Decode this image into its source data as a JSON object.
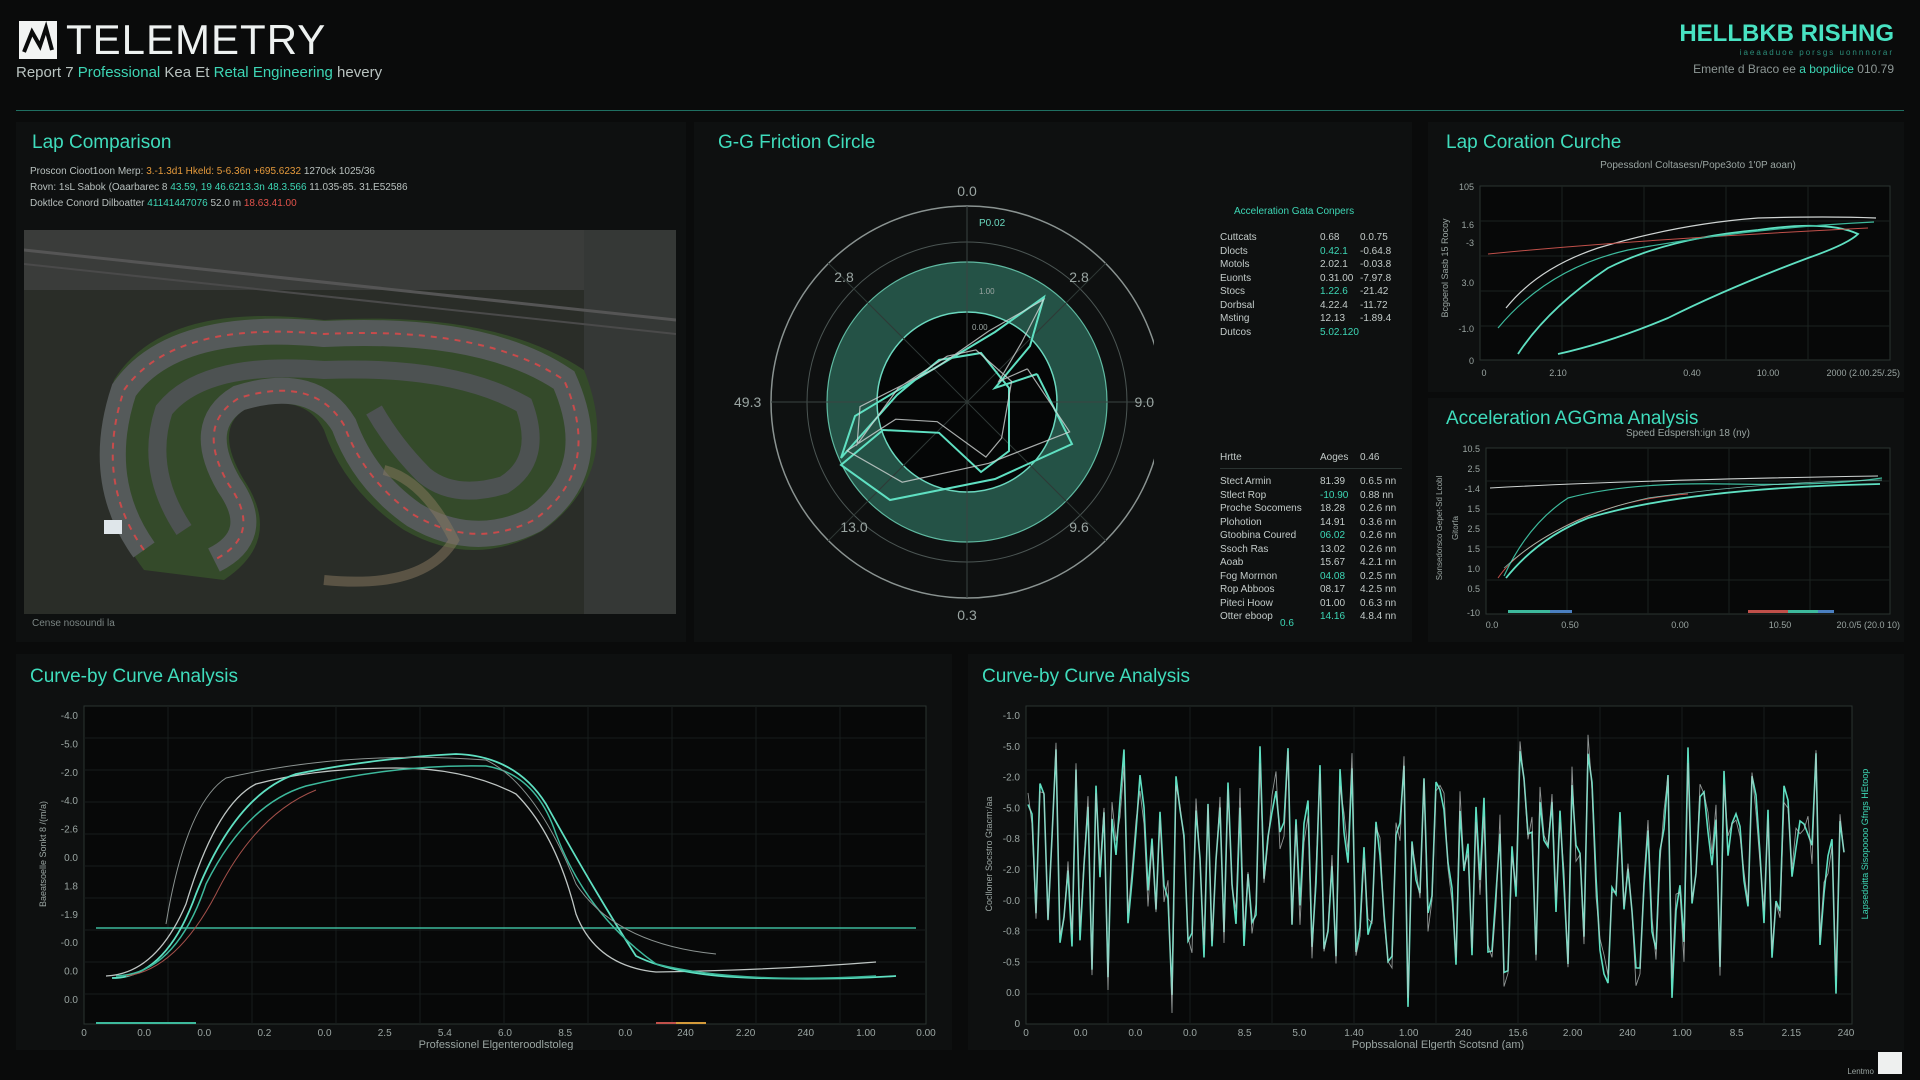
{
  "header": {
    "title": "TELEMETRY",
    "subtitle_parts": [
      "Report 7  ",
      "Professional",
      " Kea Et ",
      "Retal",
      " Engineering",
      " hevery"
    ],
    "brand": "HELLBKB RISHNG",
    "brand_sub": "iaeaaduoe porsgs uonnnorar",
    "meta_left": "Emente d Braco ee ",
    "meta_teal": "a bopdiice",
    "meta_right": "  010.79"
  },
  "lap_comparison": {
    "title": "Lap Comparison",
    "info_rows": [
      {
        "label": "Proscon Cioot1oon Merp:",
        "v1": "3.-1.3d1 Hkeld:",
        "v2": " 5-6.36n",
        "v3": " +695.6232",
        "v4": " 1270ck 1025/36"
      },
      {
        "label": "Rovn: 1sL Sabok (Oaarbarec 8",
        "v1": "43.59, 19 46.6213.3n",
        "v2": " 48.3.566",
        "v3": " 11.035-85. 31.E52586",
        "v4": ""
      },
      {
        "label": "Doktlce Conord Dilboatter",
        "v1": "41141447076",
        "v2": " 52.0 m",
        "v3": " 18.63.41.00",
        "v4": ""
      }
    ],
    "caption": "Cense nosoundi la"
  },
  "gg_circle": {
    "title": "G-G Friction Circle",
    "labels": [
      "0.0",
      "2.8",
      "2.8",
      "49.3",
      "9.0",
      "13.0",
      "9.6",
      "0.3"
    ],
    "inner_labels": [
      "P0.02",
      "1.00",
      "0.00"
    ],
    "trace": [
      [
        0.5,
        -0.2
      ],
      [
        0.75,
        0.3
      ],
      [
        0.2,
        0.55
      ],
      [
        -0.55,
        0.7
      ],
      [
        -0.9,
        0.45
      ],
      [
        -0.6,
        0.2
      ],
      [
        -0.2,
        0.22
      ],
      [
        0.1,
        0.5
      ],
      [
        0.3,
        0.35
      ],
      [
        0.3,
        -0.1
      ],
      [
        0.1,
        -0.35
      ],
      [
        -0.2,
        -0.3
      ],
      [
        -0.5,
        -0.05
      ],
      [
        -0.9,
        0.4
      ],
      [
        -0.8,
        0.1
      ],
      [
        -0.3,
        -0.2
      ],
      [
        0.2,
        -0.5
      ],
      [
        0.55,
        -0.75
      ],
      [
        0.45,
        -0.4
      ],
      [
        0.2,
        -0.1
      ],
      [
        0.5,
        -0.2
      ]
    ]
  },
  "acc_stats": {
    "header": "Acceleration Gata Conpers",
    "rows1": [
      {
        "k": "Cuttcats",
        "a": "0.68",
        "b": "0.0.75"
      },
      {
        "k": "Dlocts",
        "a": "0.42.1",
        "b": "-0.64.8"
      },
      {
        "k": "Motols",
        "a": "2.02.1",
        "b": "-0.03.8"
      },
      {
        "k": "Euonts",
        "a": "0.31.00",
        "b": "-7.97.8"
      },
      {
        "k": "Stocs",
        "a": "1.22.6",
        "b": "-21.42"
      },
      {
        "k": "Dorbsal",
        "a": "4.22.4",
        "b": "-11.72"
      },
      {
        "k": "Msting",
        "a": "12.13",
        "b": "-1.89.4"
      },
      {
        "k": "Dutcos",
        "a": "5.02.120",
        "b": ""
      }
    ],
    "sub_header": {
      "k": "Hrtte",
      "a": "Aoges",
      "b": "0.46"
    },
    "rows2": [
      {
        "k": "Stect Armin",
        "a": "81.39",
        "b": "0.6.5 nn"
      },
      {
        "k": "Stlect Rop",
        "a": "-10.90",
        "b": "0.88 nn"
      },
      {
        "k": "Proche Socomens",
        "a": "18.28",
        "b": "0.2.6 nn"
      },
      {
        "k": "Plohotion",
        "a": "14.91",
        "b": "0.3.6 nn"
      },
      {
        "k": "Gtoobina Coured",
        "a": "06.02",
        "b": "0.2.6 nn"
      },
      {
        "k": "Ssoch Ras",
        "a": "13.02",
        "b": "0.2.6 nn"
      },
      {
        "k": "Aoab",
        "a": "15.67",
        "b": "4.2.1 nn"
      },
      {
        "k": "Fog Morrnon",
        "a": "04.08",
        "b": "0.2.5 nn"
      },
      {
        "k": "Rop Abboos",
        "a": "08.17",
        "b": "4.2.5 nn"
      },
      {
        "k": "Piteci Hoow",
        "a": "01.00",
        "b": "0.6.3 nn"
      },
      {
        "k": "Otter eboop",
        "a": "14.16",
        "b": "4.8.4 nn"
      }
    ],
    "footer": "0.6"
  },
  "lap_coration": {
    "title": "Lap Coration Curche",
    "chart_title": "Popessdonl Coltasesn/Pope3oto 1'0P aoan)",
    "ylabel": "Bcgoerol Sasb 15 Rocoy",
    "yticks": [
      "105",
      "1.6",
      "-3",
      "3.0",
      "-1.0",
      "0"
    ],
    "xticks": [
      "0",
      "2.10",
      "0.40",
      "10.00",
      "2000 (2.00.25/.25)"
    ]
  },
  "acc_analysis": {
    "title": "Acceleration AGGma Analysis",
    "chart_title": "Speed Edspersh:ign 18 (ny)",
    "ylabel": "Sonsedorsco Gepet-Sd Lcobl",
    "ylabel2": "Gitorfa",
    "yticks": [
      "10.5",
      "2.5",
      "-1.4",
      "1.5",
      "2.5",
      "1.5",
      "1.0",
      "0.5",
      "-10"
    ],
    "xticks": [
      "0.0",
      "0.50",
      "0.00",
      "10.50",
      "20.0/5 (20.0 10)"
    ]
  },
  "curve_left": {
    "title": "Curve-by Curve Analysis",
    "ylabel": "Baeatsoelle Sonkt 8 /(m/a)",
    "yticks": [
      "-4.0",
      "-5.0",
      "-2.0",
      "-4.0",
      "-2.6",
      "0.0",
      "1.8",
      "-1.9",
      "-0.0",
      "0.0",
      "0.0"
    ],
    "xticks": [
      "0",
      "0.0",
      "0.0",
      "0.2",
      "0.0",
      "2.5",
      "5.4",
      "6.0",
      "8.5",
      "0.0",
      "240",
      "2.20",
      "240",
      "1.00",
      "0.00"
    ],
    "xlabel": "Professionel Elgenteroodlstoleg"
  },
  "curve_right": {
    "title": "Curve-by Curve Analysis",
    "ylabel": "Coclloner Socstro Gtacm:/aa",
    "ylabel2": "Lapsedoitta Sisopoooo Gfngs HEtoop",
    "yticks": [
      "-1.0",
      "-5.0",
      "-2.0",
      "-5.0",
      "-0.8",
      "-2.0",
      "-0.0",
      "-0.8",
      "-0.5",
      "0.0",
      "0"
    ],
    "xticks": [
      "0",
      "0.0",
      "0.0",
      "0.0",
      "8.5",
      "5.0",
      "1.40",
      "1.00",
      "240",
      "15.6",
      "2.00",
      "240",
      "1.00",
      "8.5",
      "2.15",
      "240"
    ],
    "xlabel": "Popbssalonal Elgerth Scotsnd (am)"
  },
  "footer": {
    "text": "Lentmo"
  },
  "colors": {
    "accent": "#3dd6b5",
    "accent_dark": "#1f6f61",
    "trace_white": "#cfd4d3"
  }
}
